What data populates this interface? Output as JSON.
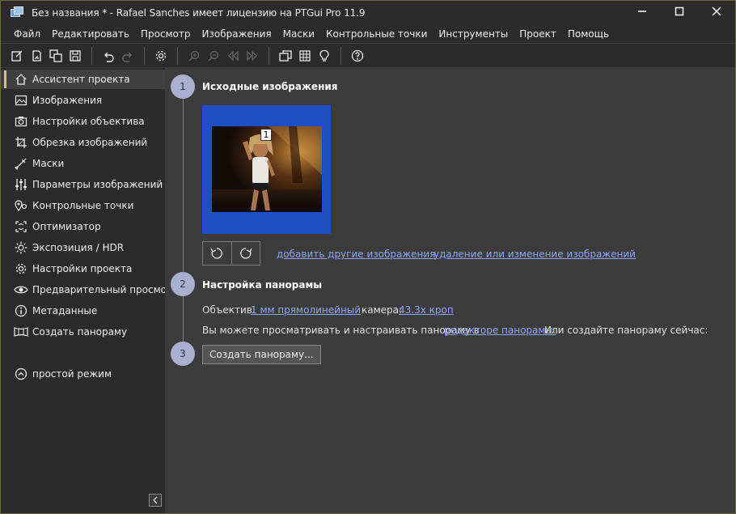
{
  "window": {
    "title": "Без названия * - Rafael Sanches имеет лицензию на PTGui Pro 11.9"
  },
  "menu": [
    "Файл",
    "Редактировать",
    "Просмотр",
    "Изображения",
    "Маски",
    "Контрольные точки",
    "Инструменты",
    "Проект",
    "Помощь"
  ],
  "sidebar": {
    "items": [
      {
        "label": "Ассистент проекта",
        "icon": "home-icon"
      },
      {
        "label": "Изображения",
        "icon": "image-icon"
      },
      {
        "label": "Настройки объектива",
        "icon": "camera-icon"
      },
      {
        "label": "Обрезка изображений",
        "icon": "crop-icon"
      },
      {
        "label": "Маски",
        "icon": "brush-icon"
      },
      {
        "label": "Параметры изображений",
        "icon": "sliders-icon"
      },
      {
        "label": "Контрольные точки",
        "icon": "control-points-icon"
      },
      {
        "label": "Оптимизатор",
        "icon": "optimizer-icon"
      },
      {
        "label": "Экспозиция / HDR",
        "icon": "sun-icon"
      },
      {
        "label": "Настройки проекта",
        "icon": "gear-icon"
      },
      {
        "label": "Предварительный просмотр",
        "icon": "eye-icon"
      },
      {
        "label": "Метаданные",
        "icon": "info-icon"
      },
      {
        "label": "Создать панораму",
        "icon": "panorama-icon"
      }
    ],
    "simple_mode": "простой режим"
  },
  "steps": {
    "s1": {
      "number": "1",
      "title": "Исходные изображения",
      "badge": "1"
    },
    "s2": {
      "number": "2",
      "title": "Настройка панорамы"
    },
    "s3": {
      "number": "3"
    }
  },
  "links": {
    "add_images": "добавить другие изображения",
    "remove_images": "удаление или изменение изображений"
  },
  "panorama_settings": {
    "lens_label": "Объектив:",
    "lens_value": "1 мм прямолинейный",
    "camera_label": "камера:",
    "camera_value": "43.3x кроп",
    "info_before": "Вы можете  просматривать и настраивать панораму в",
    "editor_link": "редакторе панорамы.",
    "info_after": "Или создайте панораму сейчас:"
  },
  "create_button": "Создать панораму...",
  "colors": {
    "accent": "#d7c66b",
    "step_circle": "#a9b0cf",
    "link": "#8fa6ff",
    "thumb_bg": "#1f4fc2"
  }
}
